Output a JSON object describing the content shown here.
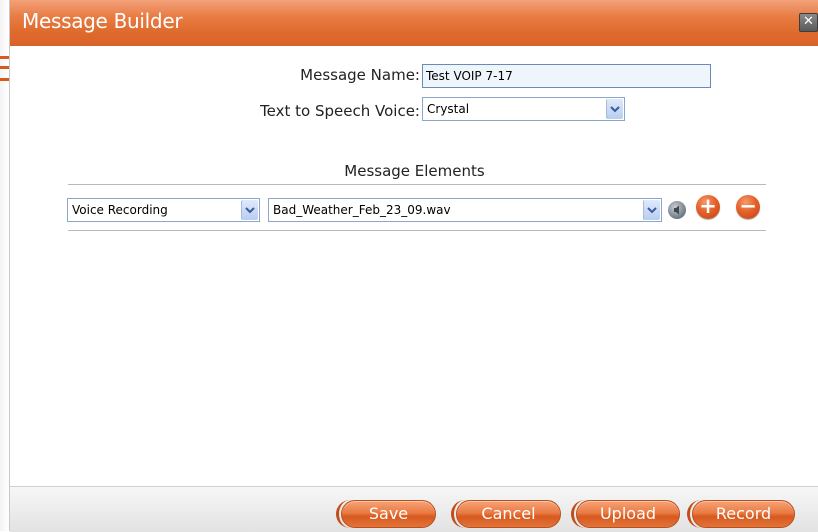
{
  "window": {
    "title": "Message Builder",
    "close_glyph": "✕"
  },
  "form": {
    "message_name_label": "Message Name:",
    "message_name_value": "Test VOIP 7-17",
    "tts_voice_label": "Text to Speech Voice:",
    "tts_voice_value": "Crystal"
  },
  "elements_section": {
    "heading": "Message Elements",
    "rows": [
      {
        "type_value": "Voice Recording",
        "file_value": "Bad_Weather_Feb_23_09.wav",
        "play_icon": "speaker-icon",
        "add_glyph": "+",
        "remove_glyph": "−"
      }
    ]
  },
  "footer": {
    "save_label": "Save",
    "cancel_label": "Cancel",
    "upload_label": "Upload",
    "record_label": "Record"
  },
  "colors": {
    "accent": "#e0662c",
    "title_text": "#ffffff",
    "input_bg": "#eef5fb"
  }
}
